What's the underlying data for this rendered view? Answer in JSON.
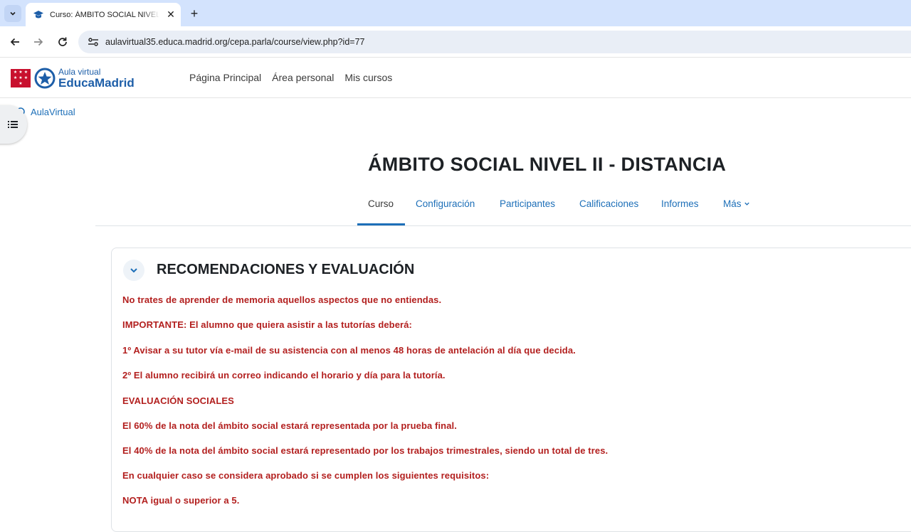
{
  "browser": {
    "tab_title": "Curso: ÁMBITO SOCIAL NIVEL II - DISTANCIA",
    "url": "aulavirtual35.educa.madrid.org/cepa.parla/course/view.php?id=77"
  },
  "header": {
    "logo_small": "Aula virtual",
    "logo_big": "EducaMadrid",
    "nav": [
      "Página Principal",
      "Área personal",
      "Mis cursos"
    ]
  },
  "breadcrumb": "AulaVirtual",
  "course": {
    "title": "ÁMBITO SOCIAL NIVEL II - DISTANCIA",
    "tabs": [
      "Curso",
      "Configuración",
      "Participantes",
      "Calificaciones",
      "Informes",
      "Más"
    ]
  },
  "section": {
    "title": "RECOMENDACIONES Y EVALUACIÓN",
    "paragraphs": [
      "No trates de aprender de memoria aquellos aspectos que no entiendas.",
      "IMPORTANTE: El alumno que quiera asistir a las tutorías deberá:",
      "1º Avisar a su tutor vía e-mail de su asistencia con al menos 48 horas de antelación al día que decida.",
      "2º El alumno recibirá un correo indicando el horario y día para la tutoría.",
      "EVALUACIÓN SOCIALES",
      "El 60% de la nota del ámbito social estará representada por la prueba final.",
      "El 40% de la nota del ámbito social estará representado por los trabajos trimestrales, siendo un total de tres.",
      "En cualquier caso se considera aprobado si se cumplen los siguientes requisitos:",
      "NOTA igual o superior a 5."
    ]
  },
  "colors": {
    "link": "#1d6fb8",
    "text_red": "#b3201f",
    "madrid_red": "#c8102e"
  }
}
